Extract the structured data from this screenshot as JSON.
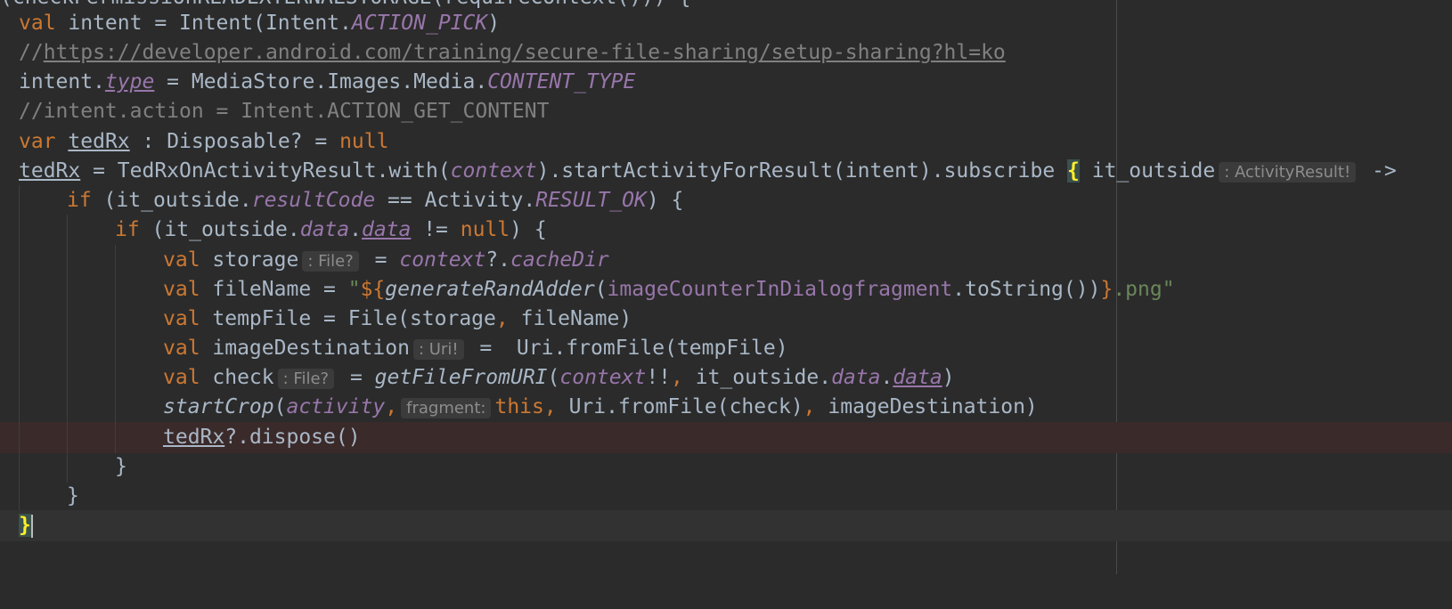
{
  "code": {
    "l0_cut": "(checkPermissionREADEXTERNALSTORAGE(requireContext())) {",
    "l1": {
      "kw": "val",
      "rest1": " intent = Intent(Intent.",
      "fld": "ACTION_PICK",
      "rest2": ")"
    },
    "l2": {
      "slashes": "//",
      "url": "https://developer.android.com/training/secure-file-sharing/setup-sharing?hl=ko"
    },
    "l3": {
      "a": "intent.",
      "prop": "type",
      "b": " = MediaStore.Images.Media.",
      "fld": "CONTENT_TYPE"
    },
    "l4": {
      "comment": "//intent.action = Intent.ACTION_GET_CONTENT"
    },
    "l5": {
      "kw": "var",
      "sp": " ",
      "var": "tedRx",
      "a": " : Disposable? = ",
      "null": "null"
    },
    "l6": {
      "var": "tedRx",
      "a": " = TedRxOnActivityResult.with(",
      "ctx": "context",
      "b": ").startActivityForResult(intent).subscribe ",
      "brace": "{",
      "c": " it_outside",
      "hint": ": ActivityResult!",
      "arrow": " ->"
    },
    "l7": {
      "kw": "if",
      "a": " (it_outside.",
      "prop": "resultCode",
      "b": " == Activity.",
      "fld": "RESULT_OK",
      "c": ") {"
    },
    "l8": {
      "kw": "if",
      "a": " (it_outside.",
      "prop1": "data",
      "dot": ".",
      "prop2": "data",
      "b": " != ",
      "null": "null",
      "c": ") {"
    },
    "l9": {
      "kw": "val",
      "a": " storage",
      "hint": ": File?",
      "b": " = ",
      "ctx": "context",
      "c": "?.",
      "prop": "cacheDir"
    },
    "l10": {
      "kw": "val",
      "a": " fileName = ",
      "q": "\"",
      "tmpl": "${",
      "fn": "generateRandAdder",
      "p1": "(",
      "fld": "imageCounterInDialogfragment",
      "b": ".toString())",
      "tmplEnd": "}",
      "str": ".png\""
    },
    "l11": {
      "kw": "val",
      "a": " tempFile = File(storage",
      "comma": ",",
      "b": " fileName)"
    },
    "l12": {
      "kw": "val",
      "a": " imageDestination",
      "hint": ": Uri!",
      "b": " =  Uri.fromFile(tempFile)"
    },
    "l13": {
      "kw": "val",
      "a": " check",
      "hint": ": File?",
      "b": " = ",
      "fn": "getFileFromURI",
      "p": "(",
      "ctx": "context",
      "c": "!!",
      "comma": ",",
      "d": " it_outside.",
      "prop1": "data",
      "dot": ".",
      "prop2": "data",
      "e": ")"
    },
    "l14": {
      "fn": "startCrop",
      "p": "(",
      "act": "activity",
      "comma": ",",
      "hint": "fragment:",
      "this": "this",
      "comma2": ",",
      "a": " Uri.fromFile(check)",
      "comma3": ",",
      "b": " imageDestination)"
    },
    "l15": {
      "var": "tedRx",
      "a": "?.dispose()"
    },
    "l16": {
      "a": "}"
    },
    "l17": {
      "a": "}"
    },
    "l18": {
      "brace": "}"
    }
  },
  "colors": {
    "background": "#2b2b2b",
    "keyword": "#cc7832",
    "property": "#9876aa",
    "string": "#6a8759",
    "comment": "#808080",
    "text": "#a9b7c6",
    "errorLine": "#3b2a2a"
  }
}
